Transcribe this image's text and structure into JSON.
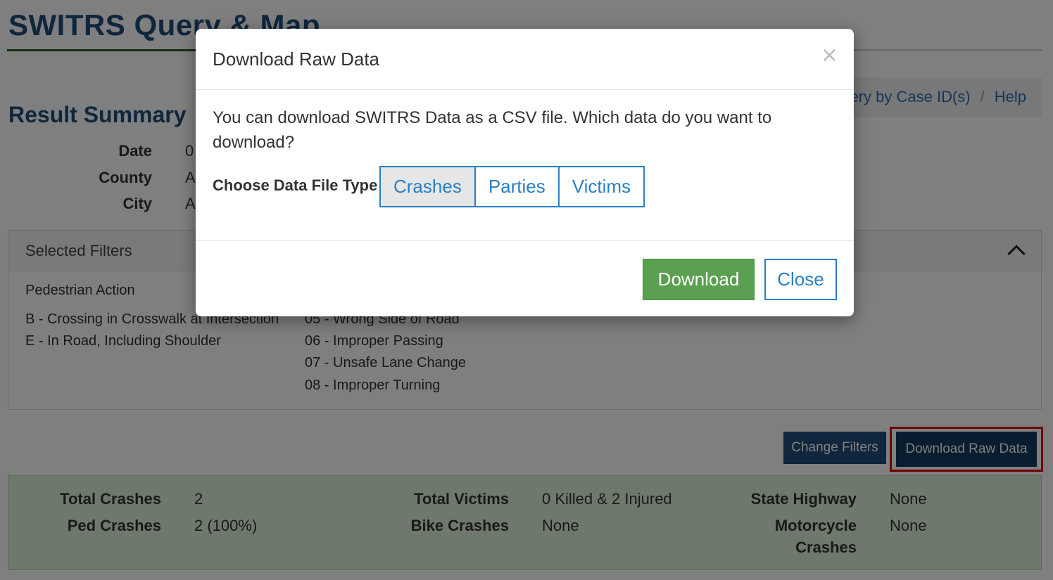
{
  "page": {
    "title": "SWITRS Query & Map",
    "breadcrumb": {
      "partial_item": "ery by Case ID(s)",
      "separator": "/",
      "help": "Help"
    },
    "result_summary": {
      "title": "Result Summary",
      "rows": [
        {
          "label": "Date",
          "value_fragment": "0"
        },
        {
          "label": "County",
          "value_fragment": "A"
        },
        {
          "label": "City",
          "value_fragment": "A"
        }
      ]
    },
    "filters": {
      "header": "Selected Filters",
      "group_title": "Pedestrian Action",
      "col1": [
        "B - Crossing in Crosswalk at Intersection",
        "E - In Road, Including Shoulder"
      ],
      "col2": [
        "05 - Wrong Side of Road",
        "06 - Improper Passing",
        "07 - Unsafe Lane Change",
        "08 - Improper Turning"
      ]
    },
    "buttons": {
      "change_filters": "Change Filters",
      "download_raw": "Download Raw Data"
    },
    "stats": {
      "total_crashes_label": "Total Crashes",
      "total_crashes": "2",
      "ped_crashes_label": "Ped Crashes",
      "ped_crashes": "2 (100%)",
      "total_victims_label": "Total Victims",
      "total_victims": "0 Killed & 2 Injured",
      "bike_crashes_label": "Bike Crashes",
      "bike_crashes": "None",
      "state_highway_label": "State Highway",
      "state_highway": "None",
      "motorcycle_label_1": "Motorcycle",
      "motorcycle_label_2": "Crashes",
      "motorcycle": "None"
    }
  },
  "modal": {
    "title": "Download Raw Data",
    "close_glyph": "×",
    "body_text": "You can download SWITRS Data as a CSV file. Which data do you want to download?",
    "choose_label": "Choose Data File Type",
    "file_types": [
      "Crashes",
      "Parties",
      "Victims"
    ],
    "selected_type": "Crashes",
    "download_label": "Download",
    "close_label": "Close"
  },
  "colors": {
    "brand_blue": "#1f4d7a",
    "link_blue": "#2a7fc4",
    "download_green": "#5aa050",
    "highlight_red": "#e00000"
  }
}
